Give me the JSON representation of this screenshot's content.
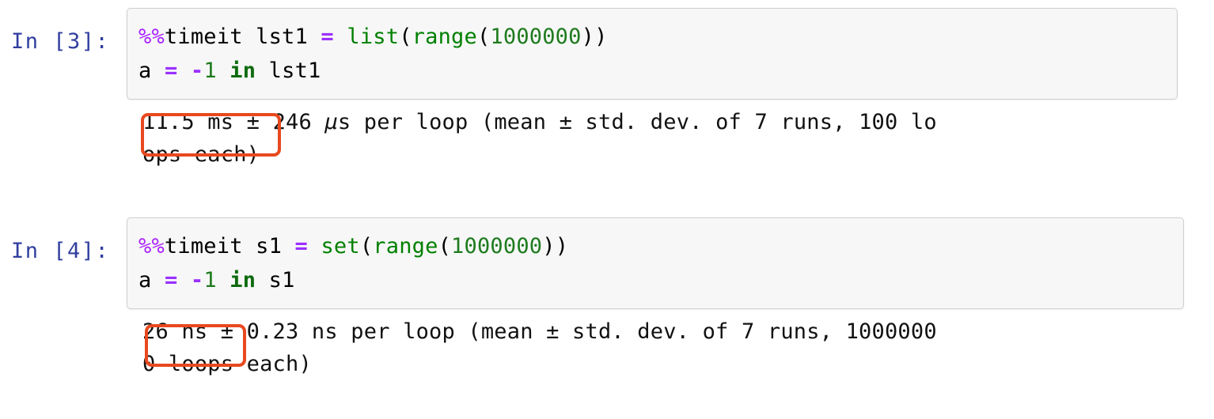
{
  "theme": {
    "background": "#ffffff",
    "prompt_color": "#303F9F",
    "code_bg": "#f7f7f7",
    "code_border": "#cfcfcf",
    "annotation_color": "#E8491F",
    "magic_color": "#AA22FF",
    "operator_color": "#9B30FF",
    "builtin_color": "#008000",
    "number_color": "#1E7B1E",
    "keyword_color": "#0E6B0E"
  },
  "cells": [
    {
      "prompt": "In [3]:",
      "execution_count": 3,
      "code_line_1": {
        "magic": "%%",
        "magic_name": "timeit",
        "space_1": " ",
        "var": "lst1",
        "space_2": " ",
        "equals": "=",
        "space_3": " ",
        "builtin_outer": "list",
        "paren_open_1": "(",
        "builtin_inner": "range",
        "paren_open_2": "(",
        "number": "1000000",
        "paren_close": "))"
      },
      "code_line_2": {
        "var": "a",
        "space_1": " ",
        "equals": "=",
        "space_2": " ",
        "minus": "-",
        "number": "1",
        "space_3": " ",
        "keyword": "in",
        "space_4": " ",
        "operand": "lst1"
      },
      "output_full": "11.5 ms ± 246 µs per loop (mean ± std. dev. of 7 runs, 100 loops each)",
      "output_line_1_pre": "11.5 ms",
      "output_line_1_rest_a": " ± 246 ",
      "output_line_1_mu": "µ",
      "output_line_1_rest_b": "s per loop (mean ± std. dev. of 7 runs, 100 lo",
      "output_line_2": "ops each)",
      "highlighted_value": "11.5 ms"
    },
    {
      "prompt": "In [4]:",
      "execution_count": 4,
      "code_line_1": {
        "magic": "%%",
        "magic_name": "timeit",
        "space_1": " ",
        "var": "s1",
        "space_2": " ",
        "equals": "=",
        "space_3": " ",
        "builtin_outer": "set",
        "paren_open_1": "(",
        "builtin_inner": "range",
        "paren_open_2": "(",
        "number": "1000000",
        "paren_close": "))"
      },
      "code_line_2": {
        "var": "a",
        "space_1": " ",
        "equals": "=",
        "space_2": " ",
        "minus": "-",
        "number": "1",
        "space_3": " ",
        "keyword": "in",
        "space_4": " ",
        "operand": "s1"
      },
      "output_full": "26 ns ± 0.23 ns per loop (mean ± std. dev. of 7 runs, 10000000 loops each)",
      "output_line_1_pre": "26 ns",
      "output_line_1_rest_a": " ± 0.23 ns per loop (mean ± std. dev. of 7 runs, 1000000",
      "output_line_1_mu": "",
      "output_line_1_rest_b": "",
      "output_line_2": "0 loops each)",
      "highlighted_value": "26 ns"
    }
  ]
}
